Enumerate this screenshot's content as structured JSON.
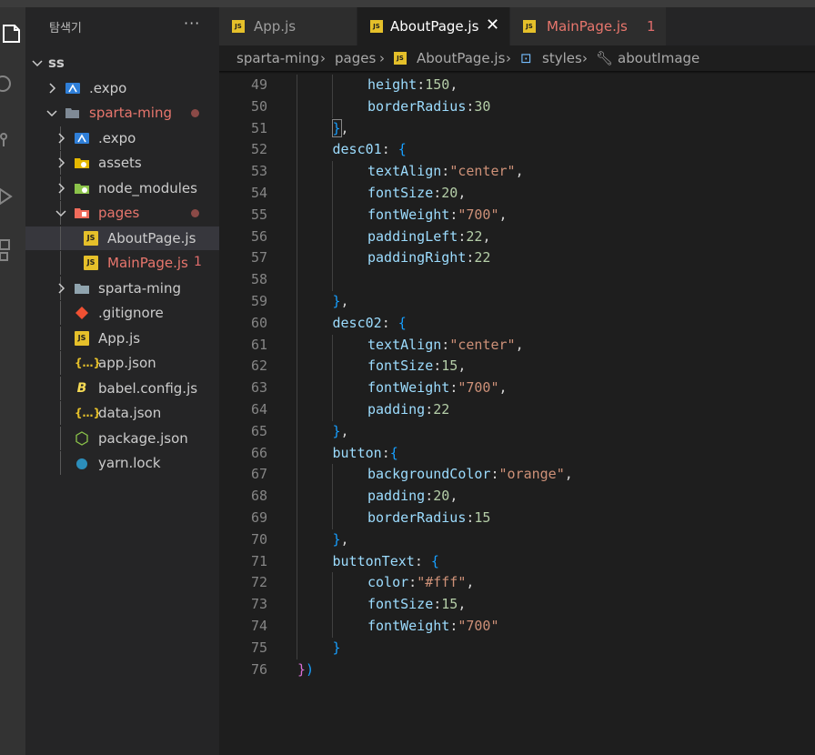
{
  "sidebar": {
    "title": "탐색기",
    "more": "···",
    "tree": [
      {
        "label": "ss",
        "kind": "root",
        "open": true
      },
      {
        "label": ".expo",
        "kind": "folder-expo",
        "open": false
      },
      {
        "label": "sparta-ming",
        "kind": "folder-open",
        "open": true,
        "modified": true
      },
      {
        "label": ".expo",
        "kind": "folder-expo",
        "open": false
      },
      {
        "label": "assets",
        "kind": "folder-assets",
        "open": false
      },
      {
        "label": "node_modules",
        "kind": "folder-node",
        "open": false
      },
      {
        "label": "pages",
        "kind": "folder-pages",
        "open": true,
        "modified": true
      },
      {
        "label": "AboutPage.js",
        "kind": "js",
        "selected": true
      },
      {
        "label": "MainPage.js",
        "kind": "js",
        "modified": true,
        "badge": "1"
      },
      {
        "label": "sparta-ming",
        "kind": "folder",
        "open": false
      },
      {
        "label": ".gitignore",
        "kind": "git"
      },
      {
        "label": "App.js",
        "kind": "js"
      },
      {
        "label": "app.json",
        "kind": "json"
      },
      {
        "label": "babel.config.js",
        "kind": "babel"
      },
      {
        "label": "data.json",
        "kind": "json"
      },
      {
        "label": "package.json",
        "kind": "nodejs"
      },
      {
        "label": "yarn.lock",
        "kind": "yarn"
      }
    ]
  },
  "tabs": [
    {
      "label": "App.js",
      "active": false
    },
    {
      "label": "AboutPage.js",
      "active": true,
      "close": "✕"
    },
    {
      "label": "MainPage.js",
      "active": false,
      "modified": true,
      "badge": "1"
    }
  ],
  "tab_icon_text": "JS",
  "breadcrumb": {
    "items": [
      "sparta-ming",
      "pages",
      "AboutPage.js",
      "styles",
      "aboutImage"
    ],
    "sep": "›"
  },
  "editor": {
    "lines": [
      {
        "n": "49",
        "tokens": [
          {
            "t": "height",
            "c": "prop"
          },
          {
            "t": ":",
            "c": "pun"
          },
          {
            "t": "150",
            "c": "num"
          },
          {
            "t": ",",
            "c": "pun"
          }
        ],
        "indent": 2
      },
      {
        "n": "50",
        "tokens": [
          {
            "t": "borderRadius",
            "c": "prop"
          },
          {
            "t": ":",
            "c": "pun"
          },
          {
            "t": "30",
            "c": "num"
          }
        ],
        "indent": 2
      },
      {
        "n": "51",
        "tokens": [
          {
            "t": "}",
            "c": "brc",
            "box": true
          },
          {
            "t": ",",
            "c": "pun"
          }
        ],
        "indent": 1
      },
      {
        "n": "52",
        "tokens": [
          {
            "t": "desc01",
            "c": "prop"
          },
          {
            "t": ": ",
            "c": "pun"
          },
          {
            "t": "{",
            "c": "brc"
          }
        ],
        "indent": 1
      },
      {
        "n": "53",
        "tokens": [
          {
            "t": "textAlign",
            "c": "prop"
          },
          {
            "t": ":",
            "c": "pun"
          },
          {
            "t": "\"center\"",
            "c": "str"
          },
          {
            "t": ",",
            "c": "pun"
          }
        ],
        "indent": 2
      },
      {
        "n": "54",
        "tokens": [
          {
            "t": "fontSize",
            "c": "prop"
          },
          {
            "t": ":",
            "c": "pun"
          },
          {
            "t": "20",
            "c": "num"
          },
          {
            "t": ",",
            "c": "pun"
          }
        ],
        "indent": 2
      },
      {
        "n": "55",
        "tokens": [
          {
            "t": "fontWeight",
            "c": "prop"
          },
          {
            "t": ":",
            "c": "pun"
          },
          {
            "t": "\"700\"",
            "c": "str"
          },
          {
            "t": ",",
            "c": "pun"
          }
        ],
        "indent": 2
      },
      {
        "n": "56",
        "tokens": [
          {
            "t": "paddingLeft",
            "c": "prop"
          },
          {
            "t": ":",
            "c": "pun"
          },
          {
            "t": "22",
            "c": "num"
          },
          {
            "t": ",",
            "c": "pun"
          }
        ],
        "indent": 2
      },
      {
        "n": "57",
        "tokens": [
          {
            "t": "paddingRight",
            "c": "prop"
          },
          {
            "t": ":",
            "c": "pun"
          },
          {
            "t": "22",
            "c": "num"
          }
        ],
        "indent": 2
      },
      {
        "n": "58",
        "tokens": [],
        "indent": 2
      },
      {
        "n": "59",
        "tokens": [
          {
            "t": "}",
            "c": "brc"
          },
          {
            "t": ",",
            "c": "pun"
          }
        ],
        "indent": 1
      },
      {
        "n": "60",
        "tokens": [
          {
            "t": "desc02",
            "c": "prop"
          },
          {
            "t": ": ",
            "c": "pun"
          },
          {
            "t": "{",
            "c": "brc"
          }
        ],
        "indent": 1
      },
      {
        "n": "61",
        "tokens": [
          {
            "t": "textAlign",
            "c": "prop"
          },
          {
            "t": ":",
            "c": "pun"
          },
          {
            "t": "\"center\"",
            "c": "str"
          },
          {
            "t": ",",
            "c": "pun"
          }
        ],
        "indent": 2
      },
      {
        "n": "62",
        "tokens": [
          {
            "t": "fontSize",
            "c": "prop"
          },
          {
            "t": ":",
            "c": "pun"
          },
          {
            "t": "15",
            "c": "num"
          },
          {
            "t": ",",
            "c": "pun"
          }
        ],
        "indent": 2
      },
      {
        "n": "63",
        "tokens": [
          {
            "t": "fontWeight",
            "c": "prop"
          },
          {
            "t": ":",
            "c": "pun"
          },
          {
            "t": "\"700\"",
            "c": "str"
          },
          {
            "t": ",",
            "c": "pun"
          }
        ],
        "indent": 2
      },
      {
        "n": "64",
        "tokens": [
          {
            "t": "padding",
            "c": "prop"
          },
          {
            "t": ":",
            "c": "pun"
          },
          {
            "t": "22",
            "c": "num"
          }
        ],
        "indent": 2
      },
      {
        "n": "65",
        "tokens": [
          {
            "t": "}",
            "c": "brc"
          },
          {
            "t": ",",
            "c": "pun"
          }
        ],
        "indent": 1
      },
      {
        "n": "66",
        "tokens": [
          {
            "t": "button",
            "c": "prop"
          },
          {
            "t": ":",
            "c": "pun"
          },
          {
            "t": "{",
            "c": "brc"
          }
        ],
        "indent": 1
      },
      {
        "n": "67",
        "tokens": [
          {
            "t": "backgroundColor",
            "c": "prop"
          },
          {
            "t": ":",
            "c": "pun"
          },
          {
            "t": "\"orange\"",
            "c": "str"
          },
          {
            "t": ",",
            "c": "pun"
          }
        ],
        "indent": 2
      },
      {
        "n": "68",
        "tokens": [
          {
            "t": "padding",
            "c": "prop"
          },
          {
            "t": ":",
            "c": "pun"
          },
          {
            "t": "20",
            "c": "num"
          },
          {
            "t": ",",
            "c": "pun"
          }
        ],
        "indent": 2
      },
      {
        "n": "69",
        "tokens": [
          {
            "t": "borderRadius",
            "c": "prop"
          },
          {
            "t": ":",
            "c": "pun"
          },
          {
            "t": "15",
            "c": "num"
          }
        ],
        "indent": 2
      },
      {
        "n": "70",
        "tokens": [
          {
            "t": "}",
            "c": "brc"
          },
          {
            "t": ",",
            "c": "pun"
          }
        ],
        "indent": 1
      },
      {
        "n": "71",
        "tokens": [
          {
            "t": "buttonText",
            "c": "prop"
          },
          {
            "t": ": ",
            "c": "pun"
          },
          {
            "t": "{",
            "c": "brc"
          }
        ],
        "indent": 1
      },
      {
        "n": "72",
        "tokens": [
          {
            "t": "color",
            "c": "prop"
          },
          {
            "t": ":",
            "c": "pun"
          },
          {
            "t": "\"#fff\"",
            "c": "str"
          },
          {
            "t": ",",
            "c": "pun"
          }
        ],
        "indent": 2
      },
      {
        "n": "73",
        "tokens": [
          {
            "t": "fontSize",
            "c": "prop"
          },
          {
            "t": ":",
            "c": "pun"
          },
          {
            "t": "15",
            "c": "num"
          },
          {
            "t": ",",
            "c": "pun"
          }
        ],
        "indent": 2
      },
      {
        "n": "74",
        "tokens": [
          {
            "t": "fontWeight",
            "c": "prop"
          },
          {
            "t": ":",
            "c": "pun"
          },
          {
            "t": "\"700\"",
            "c": "str"
          }
        ],
        "indent": 2
      },
      {
        "n": "75",
        "tokens": [
          {
            "t": "}",
            "c": "brc"
          }
        ],
        "indent": 1
      },
      {
        "n": "76",
        "tokens": [
          {
            "t": "}",
            "c": "brm"
          },
          {
            "t": ")",
            "c": "brc"
          }
        ],
        "indent": 0
      }
    ]
  },
  "colors": {
    "accent_modified": "#e8766d",
    "js_icon": "#e5c02a",
    "editor_bg": "#1e1e1e",
    "sidebar_bg": "#252526"
  }
}
